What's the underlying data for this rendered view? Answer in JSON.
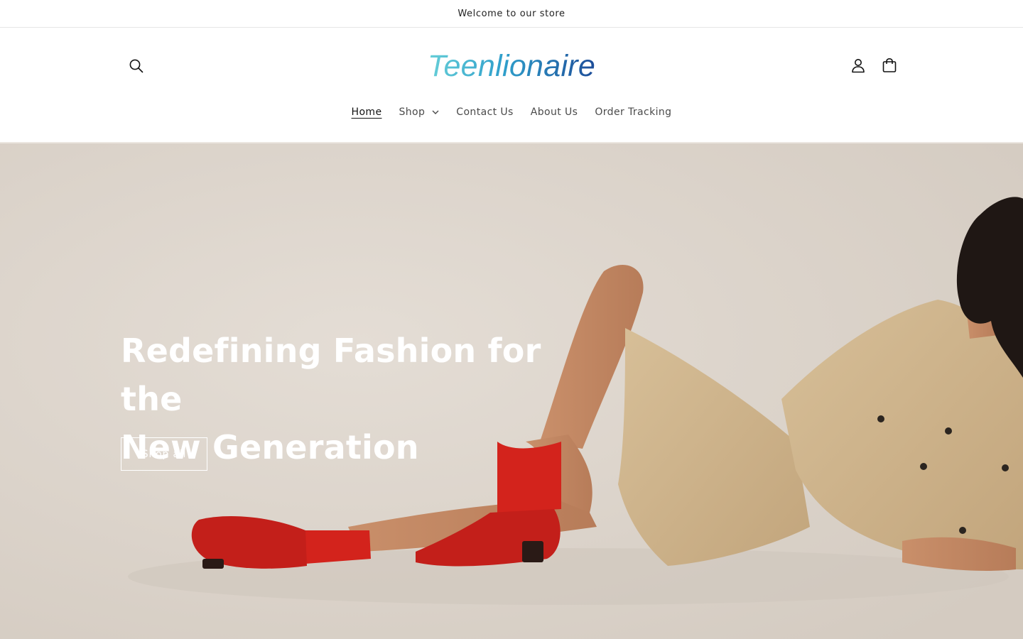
{
  "announcement": {
    "text": "Welcome to our store"
  },
  "header": {
    "logo_text": "Teenlionaire",
    "icons": {
      "search": "search-icon",
      "account": "user-icon",
      "cart": "shopping-bag-icon"
    }
  },
  "nav": {
    "items": [
      {
        "label": "Home",
        "active": true
      },
      {
        "label": "Shop",
        "has_dropdown": true
      },
      {
        "label": "Contact Us"
      },
      {
        "label": "About Us"
      },
      {
        "label": "Order Tracking"
      }
    ]
  },
  "hero": {
    "title_line1": "Redefining Fashion for the",
    "title_line2": "New Generation",
    "button_label": "Shop all",
    "image": "woman-in-beige-trench-coat-with-red-socks-and-loafers"
  },
  "colors": {
    "logo_gradient_start": "#5fc7d6",
    "logo_gradient_end": "#1f4e9a",
    "hero_background": "#dad2c9",
    "hero_text": "#ffffff"
  }
}
